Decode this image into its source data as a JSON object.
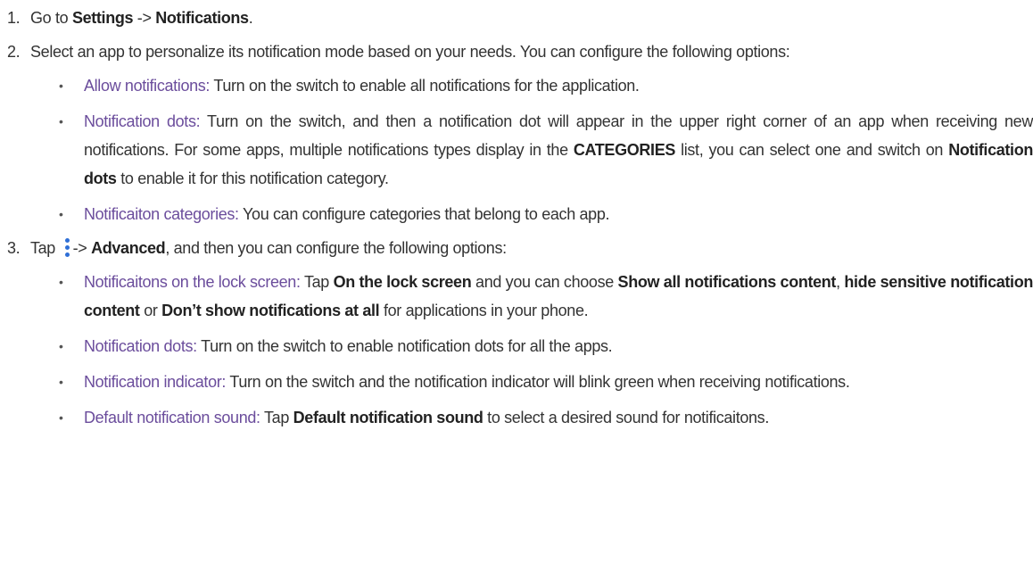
{
  "steps": [
    {
      "num": "1.",
      "parts": {
        "go": "Go to ",
        "settings": "Settings",
        "arrow": " -> ",
        "notifications": "Notifications",
        "end": "."
      }
    },
    {
      "num": "2.",
      "text": "Select an app to personalize its notification mode based on your needs. You can configure the following options:",
      "bullets": [
        {
          "term": "Allow notifications:",
          "desc": " Turn on the switch to enable all notifications for the application."
        },
        {
          "term": "Notification dots:",
          "desc_a": " Turn on the switch, and then a notification dot will appear in the upper right corner of an app when receiving new notifications. For some apps, multiple notifications types display in the ",
          "bold_a": "CATEGORIES",
          "desc_b": " list, you can select one and switch on ",
          "bold_b": "Notification dots",
          "desc_c": " to enable it for this notification category."
        },
        {
          "term": "Notificaiton categories:",
          "desc": " You can configure categories that belong to each app."
        }
      ]
    },
    {
      "num": "3.",
      "parts": {
        "tap": "Tap ",
        "arrow": "-> ",
        "advanced": "Advanced",
        "rest": ", and then you can configure the following options:"
      },
      "menu_icon": "more-vertical-icon",
      "bullets": [
        {
          "term": "Notificaitons on the lock screen:",
          "desc_a": " Tap ",
          "bold_a": "On the lock screen",
          "desc_b": " and you can choose ",
          "bold_b": "Show all notifications content",
          "desc_c": ", ",
          "bold_c": "hide sensitive notification content",
          "desc_d": " or ",
          "bold_d": "Don’t show notifications at all",
          "desc_e": " for applications in your phone."
        },
        {
          "term": "Notification dots:",
          "desc": " Turn on the switch to enable notification dots for all the apps."
        },
        {
          "term": "Notification indicator:",
          "desc": " Turn on the switch and the notification indicator will blink green when receiving notifications."
        },
        {
          "term": "Default notification sound:",
          "desc_a": " Tap ",
          "bold_a": "Default notification sound",
          "desc_b": " to select a desired sound for notificaitons."
        }
      ]
    }
  ],
  "colors": {
    "term": "#6b4d9c",
    "text": "#333333",
    "icon": "#2f6fd6"
  }
}
